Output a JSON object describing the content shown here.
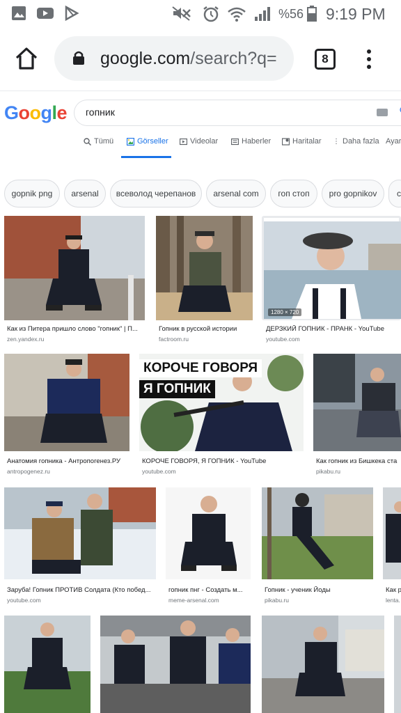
{
  "status": {
    "battery": "%56",
    "time": "9:19 PM"
  },
  "browser": {
    "url_main": "google.com",
    "url_rest": "/search?q=",
    "tab_count": "8"
  },
  "google": {
    "logo": "Google",
    "query": "гопник",
    "tabs": [
      "Tümü",
      "Görseller",
      "Videolar",
      "Haberler",
      "Haritalar",
      "Daha fazla",
      "Ayarl"
    ]
  },
  "chips": [
    "gopnik png",
    "arsenal",
    "всеволод черепанов",
    "arsenal com",
    "гоп стоп",
    "pro gopnikov",
    "c"
  ],
  "results": [
    {
      "caption": "Как из Питера пришло слово \"гопник\" | П...",
      "source": "zen.yandex.ru"
    },
    {
      "caption": "Гопник в русской истории",
      "source": "factroom.ru"
    },
    {
      "caption": "ДЕРЗКИЙ ГОПНИК - ПРАНК - YouTube",
      "source": "youtube.com",
      "dims": "1280 × 720"
    },
    {
      "caption": "Анатомия гопника - Антропогенез.РУ",
      "source": "antropogenez.ru"
    },
    {
      "caption": "КОРОЧЕ ГОВОРЯ, Я ГОПНИК - YouTube",
      "source": "youtube.com",
      "overlay1": "КОРОЧЕ ГОВОРЯ",
      "overlay2": "Я ГОПНИК"
    },
    {
      "caption": "Как гопник из Бишкека ста",
      "source": "pikabu.ru"
    },
    {
      "caption": "Заруба! Гопник ПРОТИВ Солдата (Кто побед...",
      "source": "youtube.com"
    },
    {
      "caption": "гопник пнг - Создать м...",
      "source": "meme-arsenal.com"
    },
    {
      "caption": "Гопник - ученик Йоды",
      "source": "pikabu.ru"
    },
    {
      "caption": "Как р",
      "source": "lenta."
    }
  ],
  "colors": {
    "accent": "#1a73e8",
    "tracksuit": "#1b1f2a",
    "brick": "#a0523a",
    "sky": "#cfd8e0",
    "grass": "#6f8f4a",
    "snow": "#e9eef3"
  }
}
